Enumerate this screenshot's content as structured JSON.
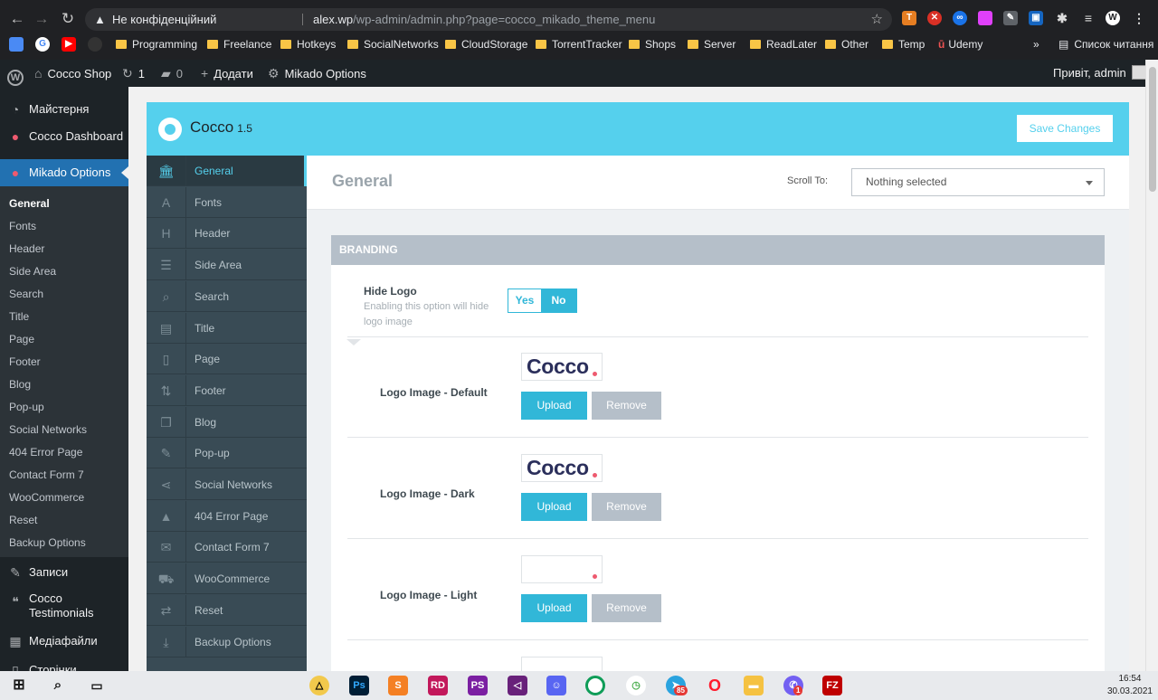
{
  "browser": {
    "address": {
      "security_label": "Не конфіденційний",
      "host": "alex.wp",
      "path": "/wp-admin/admin.php?page=cocco_mikado_theme_menu"
    },
    "bookmarks": [
      "Programming",
      "Freelance",
      "Hotkeys",
      "SocialNetworks",
      "CloudStorage",
      "TorrentTracker",
      "Shops",
      "Server",
      "ReadLater",
      "Other",
      "Temp",
      "Udemy"
    ],
    "reading_list": "Список читання",
    "overflow": "»"
  },
  "adminbar": {
    "site_name": "Cocco Shop",
    "updates_count": "1",
    "comments_count": "0",
    "add_new": "Додати",
    "mikado": "Mikado Options",
    "greeting": "Привіт, admin"
  },
  "wp_sidebar": {
    "top_items": [
      {
        "label": "Майстерня",
        "icon": "dashboard-icon"
      },
      {
        "label": "Cocco Dashboard",
        "icon": "cocco-icon"
      },
      {
        "label": "Mikado Options",
        "icon": "mikado-icon"
      }
    ],
    "submenu": [
      "General",
      "Fonts",
      "Header",
      "Side Area",
      "Search",
      "Title",
      "Page",
      "Footer",
      "Blog",
      "Pop-up",
      "Social Networks",
      "404 Error Page",
      "Contact Form 7",
      "WooCommerce",
      "Reset",
      "Backup Options"
    ],
    "bottom_items": [
      {
        "label": "Записи",
        "icon": "pin-icon"
      },
      {
        "label": "Cocco",
        "label2": "Testimonials",
        "icon": "quote-icon"
      },
      {
        "label": "Медіафайли",
        "icon": "media-icon"
      },
      {
        "label": "Сторінки",
        "icon": "page-icon"
      }
    ]
  },
  "panel": {
    "title": "Cocco",
    "version": "1.5",
    "save_label": "Save Changes",
    "nav": [
      {
        "label": "General",
        "icon": "bank-icon",
        "glyph": "🏛"
      },
      {
        "label": "Fonts",
        "icon": "font-icon",
        "glyph": "A"
      },
      {
        "label": "Header",
        "icon": "header-icon",
        "glyph": "H"
      },
      {
        "label": "Side Area",
        "icon": "list-icon",
        "glyph": "☰"
      },
      {
        "label": "Search",
        "icon": "search-icon",
        "glyph": "⌕"
      },
      {
        "label": "Title",
        "icon": "title-icon",
        "glyph": "▤"
      },
      {
        "label": "Page",
        "icon": "page-icon",
        "glyph": "▯"
      },
      {
        "label": "Footer",
        "icon": "sort-icon",
        "glyph": "⇅"
      },
      {
        "label": "Blog",
        "icon": "blog-icon",
        "glyph": "❐"
      },
      {
        "label": "Pop-up",
        "icon": "edit-icon",
        "glyph": "✎"
      },
      {
        "label": "Social Networks",
        "icon": "share-icon",
        "glyph": "⋖"
      },
      {
        "label": "404 Error Page",
        "icon": "warning-icon",
        "glyph": "▲"
      },
      {
        "label": "Contact Form 7",
        "icon": "mail-icon",
        "glyph": "✉"
      },
      {
        "label": "WooCommerce",
        "icon": "cart-icon",
        "glyph": "⛟"
      },
      {
        "label": "Reset",
        "icon": "reset-icon",
        "glyph": "⇄"
      },
      {
        "label": "Backup Options",
        "icon": "download-icon",
        "glyph": "⤓"
      }
    ],
    "heading": "General",
    "scroll_to_label": "Scroll To:",
    "scroll_to_value": "Nothing selected",
    "section_title": "BRANDING",
    "hide_logo": {
      "label": "Hide Logo",
      "description": "Enabling this option will hide logo image",
      "yes": "Yes",
      "no": "No",
      "selected": "No"
    },
    "logo_rows": [
      {
        "label": "Logo Image - Default",
        "logo_text": "Cocco",
        "upload": "Upload",
        "remove": "Remove"
      },
      {
        "label": "Logo Image - Dark",
        "logo_text": "Cocco",
        "upload": "Upload",
        "remove": "Remove"
      },
      {
        "label": "Logo Image - Light",
        "logo_text": "",
        "upload": "Upload",
        "remove": "Remove"
      }
    ]
  },
  "taskbar": {
    "time": "16:54",
    "date": "30.03.2021",
    "badges": {
      "telegram": "85",
      "viber": "1"
    }
  },
  "colors": {
    "accent": "#55d0ed",
    "button": "#31b7d8",
    "wp_active": "#2271b1"
  }
}
